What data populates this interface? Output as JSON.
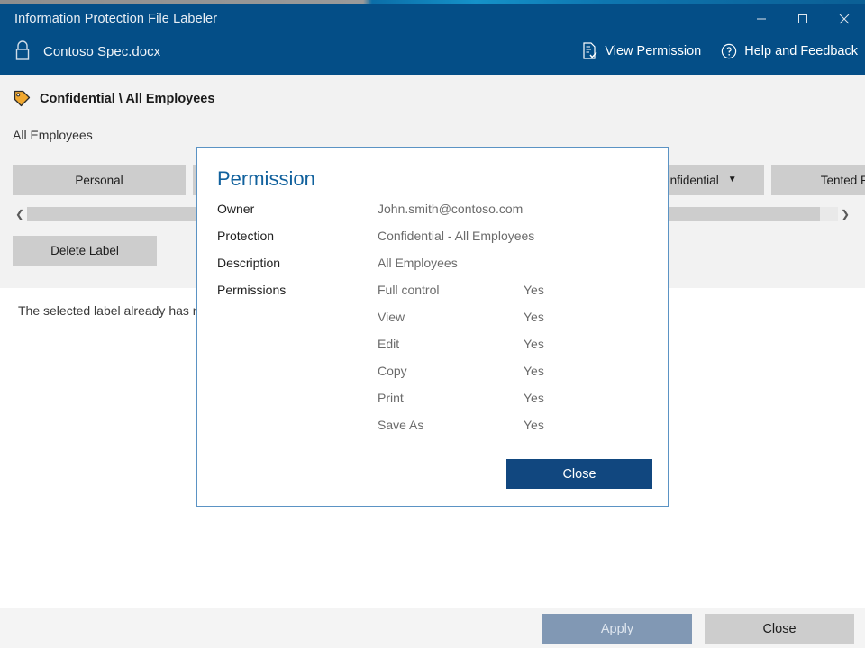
{
  "window": {
    "title": "Information Protection File Labeler",
    "controls": {
      "minimize": "minimize-icon",
      "maximize": "maximize-icon",
      "close": "close-icon"
    },
    "document_name": "Contoso Spec.docx",
    "document_icon": "lock-icon",
    "actions": [
      {
        "label": "View Permission",
        "icon": "document-permission-icon"
      },
      {
        "label": "Help and Feedback",
        "icon": "question-circle-icon"
      }
    ],
    "accent_color": "#044e87"
  },
  "label_panel": {
    "tag_icon": "tag-icon",
    "tag_color": "#f0a830",
    "title": "Confidential \\ All Employees",
    "subtitle": "All Employees",
    "chips": [
      {
        "label": "Personal",
        "has_caret": false
      },
      {
        "label": "",
        "has_caret": false
      },
      {
        "label": "",
        "has_caret": false
      },
      {
        "label": "Confidential",
        "has_caret": true
      },
      {
        "label": "Tented Projec",
        "has_caret": false
      }
    ],
    "scroll_left_icon": "chevron-left-icon",
    "scroll_right_icon": "chevron-right-icon",
    "delete_label_button": "Delete Label"
  },
  "message": {
    "text": "The selected label already has                                                                                                    ns"
  },
  "footer": {
    "apply_label": "Apply",
    "close_label": "Close"
  },
  "dialog": {
    "title": "Permission",
    "rows": [
      {
        "key": "Owner",
        "value": "John.smith@contoso.com",
        "flag": ""
      },
      {
        "key": "Protection",
        "value": "Confidential - All Employees",
        "flag": ""
      },
      {
        "key": "Description",
        "value": "All Employees",
        "flag": ""
      },
      {
        "key": "Permissions",
        "value": "Full control",
        "flag": "Yes"
      },
      {
        "key": "",
        "value": "View",
        "flag": "Yes"
      },
      {
        "key": "",
        "value": "Edit",
        "flag": "Yes"
      },
      {
        "key": "",
        "value": "Copy",
        "flag": "Yes"
      },
      {
        "key": "",
        "value": "Print",
        "flag": "Yes"
      },
      {
        "key": "",
        "value": "Save As",
        "flag": "Yes"
      }
    ],
    "close_label": "Close",
    "close_color": "#11477f",
    "title_color": "#11619d"
  }
}
